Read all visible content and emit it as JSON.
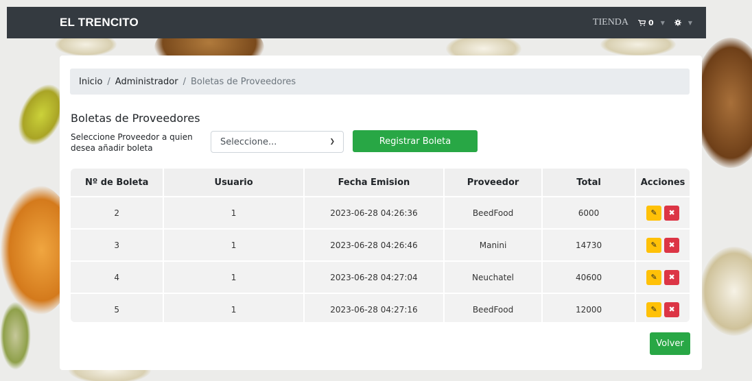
{
  "navbar": {
    "brand": "EL TRENCITO",
    "tienda_label": "TIENDA",
    "cart_icon": "cart-icon",
    "cart_count": "0",
    "settings_icon": "gear-icon"
  },
  "breadcrumb": {
    "items": [
      "Inicio",
      "Administrador",
      "Boletas de Proveedores"
    ],
    "separator": "/"
  },
  "page": {
    "title": "Boletas de Proveedores",
    "select_label": "Seleccione Proveedor a quien desea añadir boleta",
    "select_value": "Seleccione...",
    "register_button": "Registrar Boleta",
    "back_button": "Volver"
  },
  "table": {
    "headers": [
      "Nº de Boleta",
      "Usuario",
      "Fecha Emision",
      "Proveedor",
      "Total",
      "Acciones"
    ],
    "rows": [
      {
        "numero": "2",
        "usuario": "1",
        "fecha": "2023-06-28 04:26:36",
        "proveedor": "BeedFood",
        "total": "6000"
      },
      {
        "numero": "3",
        "usuario": "1",
        "fecha": "2023-06-28 04:26:46",
        "proveedor": "Manini",
        "total": "14730"
      },
      {
        "numero": "4",
        "usuario": "1",
        "fecha": "2023-06-28 04:27:04",
        "proveedor": "Neuchatel",
        "total": "40600"
      },
      {
        "numero": "5",
        "usuario": "1",
        "fecha": "2023-06-28 04:27:16",
        "proveedor": "BeedFood",
        "total": "12000"
      }
    ],
    "edit_icon": "pencil-icon",
    "delete_icon": "x-icon"
  },
  "colors": {
    "navbar": "#343a40",
    "success": "#28a745",
    "warning": "#ffc107",
    "danger": "#dc3545"
  }
}
